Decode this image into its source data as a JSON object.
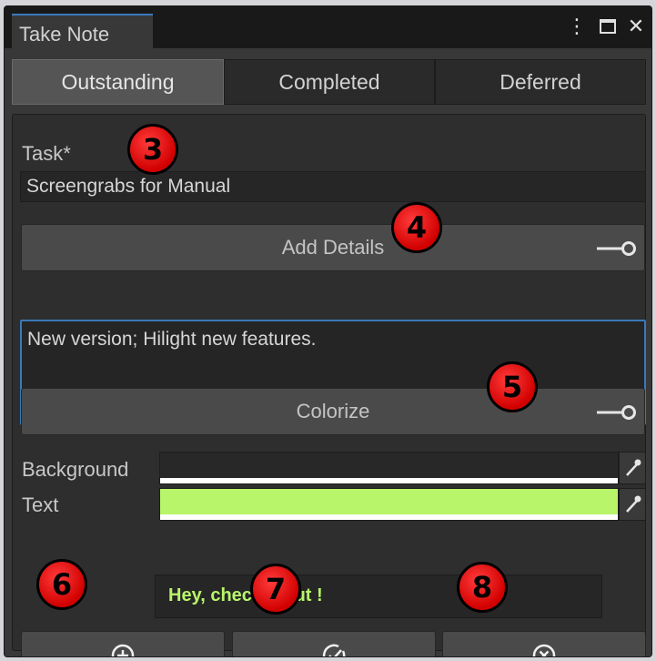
{
  "window": {
    "title": "Take Note"
  },
  "tabs": [
    {
      "label": "Outstanding",
      "active": true
    },
    {
      "label": "Completed",
      "active": false
    },
    {
      "label": "Deferred",
      "active": false
    }
  ],
  "task": {
    "label": "Task*",
    "value": "Screengrabs for Manual"
  },
  "details": {
    "button_label": "Add Details",
    "text": "New version; Hilight new features."
  },
  "colorize": {
    "button_label": "Colorize",
    "background_label": "Background",
    "background_color": "#282828",
    "text_label": "Text",
    "text_color": "#b8f56a"
  },
  "preview": {
    "text": "Hey, check it out !",
    "color": "#b8f56a"
  },
  "actions": {
    "add_icon": "plus-circle-icon",
    "complete_icon": "check-circle-icon",
    "delete_icon": "x-circle-icon"
  },
  "markers": [
    "3",
    "4",
    "5",
    "6",
    "7",
    "8"
  ],
  "colors": {
    "accent": "#3a79bb",
    "marker": "#d10000"
  }
}
